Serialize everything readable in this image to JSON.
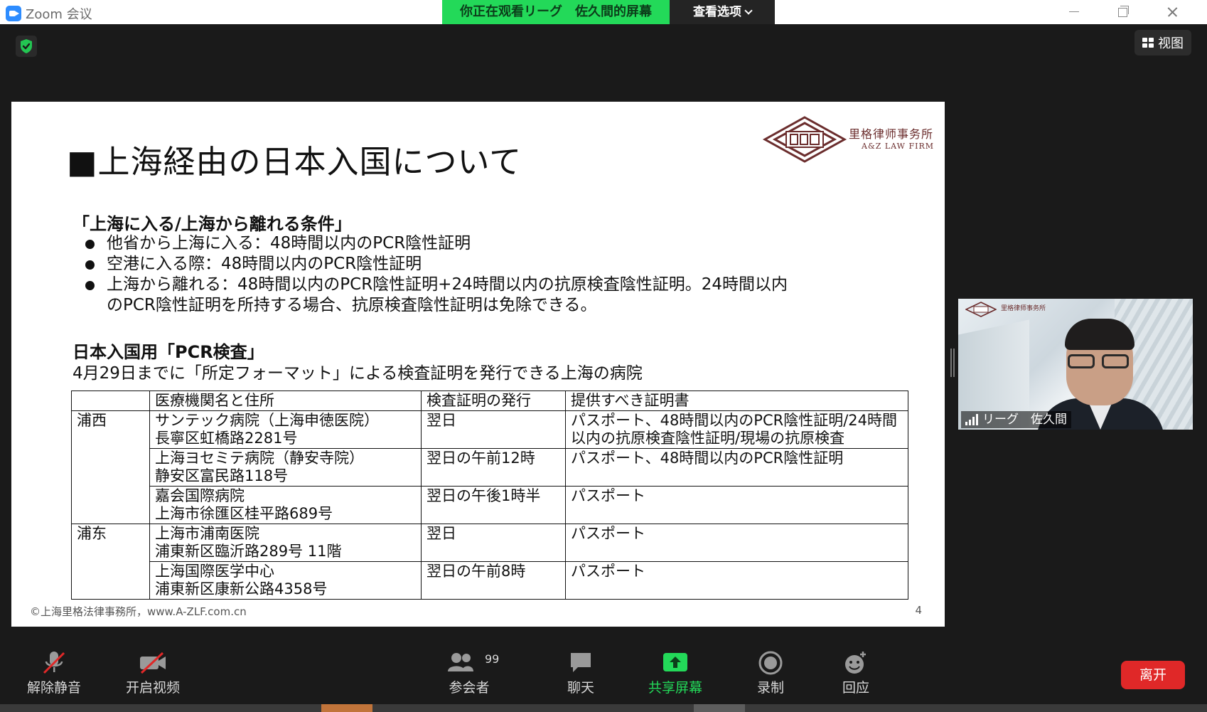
{
  "window": {
    "app_title": "Zoom 会议",
    "share_banner": "你正在观看リーグ　佐久間的屏幕",
    "view_options": "查看选项"
  },
  "top": {
    "view_label": "视图"
  },
  "slide": {
    "heading": "■上海経由の日本入国について",
    "logo": {
      "cn": "里格律师事务所",
      "en": "A&Z LAW FIRM"
    },
    "conditions_title": "「上海に入る/上海から離れる条件」",
    "conditions": [
      "他省から上海に入る：48時間以内のPCR陰性証明",
      "空港に入る際：48時間以内のPCR陰性証明",
      "上海から離れる：48時間以内のPCR陰性証明+24時間以内の抗原検査陰性証明。24時間以内のPCR陰性証明を所持する場合、抗原検査陰性証明は免除できる。"
    ],
    "pcr_title": "日本入国用「PCR検査」",
    "pcr_subtitle": "4月29日までに「所定フォーマット」による検査証明を発行できる上海の病院",
    "table": {
      "headers": [
        "",
        "医療機関名と住所",
        "検査証明の発行",
        "提供すべき証明書"
      ],
      "districts": [
        "浦西",
        "浦东"
      ],
      "rows": [
        {
          "name": "サンテック病院（上海申徳医院）",
          "address": "長寧区虹橋路2281号",
          "issue": "翌日",
          "docs": "パスポート、48時間以内のPCR陰性証明/24時間以内の抗原検査陰性証明/現場の抗原検査"
        },
        {
          "name": "上海ヨセミテ病院（静安寺院）",
          "address": "静安区富民路118号",
          "issue": "翌日の午前12時",
          "docs": "パスポート、48時間以内のPCR陰性証明"
        },
        {
          "name": "嘉会国際病院",
          "address": "上海市徐匯区桂平路689号",
          "issue": "翌日の午後1時半",
          "docs": "パスポート"
        },
        {
          "name": "上海市浦南医院",
          "address": "浦東新区臨沂路289号 11階",
          "issue": "翌日",
          "docs": "パスポート"
        },
        {
          "name": "上海国際医学中心",
          "address": "浦東新区康新公路4358号",
          "issue": "翌日の午前8時",
          "docs": "パスポート"
        }
      ]
    },
    "footer": "©上海里格法律事務所，www.A-ZLF.com.cn",
    "page_number": "4"
  },
  "video": {
    "participant_name": "リーグ　佐久間",
    "logo_text": "里格律师事务所"
  },
  "toolbar": {
    "unmute": "解除静音",
    "start_video": "开启视频",
    "participants": "参会者",
    "participants_count": "99",
    "chat": "聊天",
    "share_screen": "共享屏幕",
    "record": "录制",
    "reactions": "回应",
    "leave": "离开"
  },
  "colors": {
    "share_green": "#23d959",
    "leave_red": "#e02828",
    "zoom_blue": "#2d8cff",
    "logo_maroon": "#6b2d2d"
  }
}
